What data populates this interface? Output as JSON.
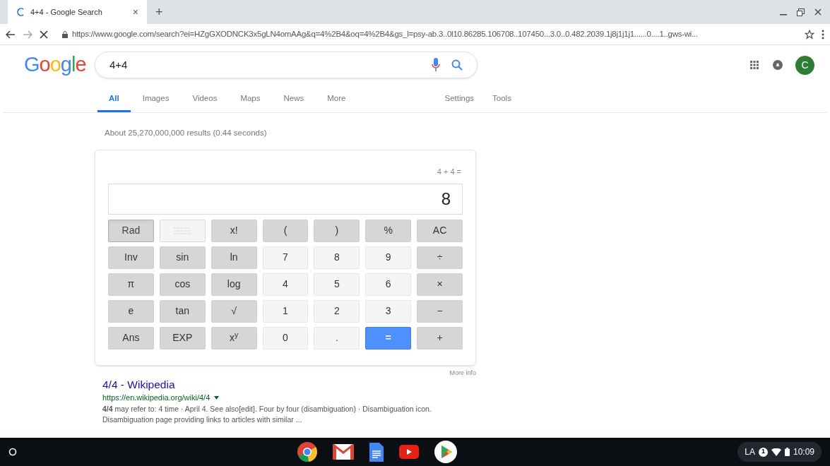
{
  "browser": {
    "tab": {
      "title": "4+4 - Google Search",
      "close": "×",
      "new_tab": "+"
    },
    "url": "https://www.google.com/search?ei=HZgGXODNCK3x5gLN4omAAg&q=4%2B4&oq=4%2B4&gs_l=psy-ab.3..0l10.86285.106708..107450...3.0..0.482.2039.1j8j1j1j1......0....1..gws-wi..."
  },
  "header": {
    "logo": "Google",
    "query": "4+4",
    "avatar": "C"
  },
  "nav": {
    "tabs": [
      {
        "label": "All",
        "selected": true
      },
      {
        "label": "Images",
        "selected": false
      },
      {
        "label": "Videos",
        "selected": false
      },
      {
        "label": "Maps",
        "selected": false
      },
      {
        "label": "News",
        "selected": false
      },
      {
        "label": "More",
        "selected": false
      }
    ],
    "right": [
      "Settings",
      "Tools"
    ]
  },
  "result_stats": "About 25,270,000,000 results (0.44 seconds)",
  "calculator": {
    "expression": "4 + 4 =",
    "display": "8",
    "more_info": "More info",
    "keys": [
      {
        "kind": "mode",
        "label": "Rad",
        "selected": true
      },
      {
        "kind": "mode",
        "selected": false
      },
      {
        "kind": "func",
        "label": "x!"
      },
      {
        "kind": "func",
        "label": "("
      },
      {
        "kind": "func",
        "label": ")"
      },
      {
        "kind": "func",
        "label": "%"
      },
      {
        "kind": "func",
        "label": "AC"
      },
      {
        "kind": "func",
        "label": "Inv"
      },
      {
        "kind": "func",
        "label": "sin"
      },
      {
        "kind": "func",
        "label": "ln"
      },
      {
        "kind": "num",
        "label": "7"
      },
      {
        "kind": "num",
        "label": "8"
      },
      {
        "kind": "num",
        "label": "9"
      },
      {
        "kind": "func",
        "label": "÷"
      },
      {
        "kind": "func",
        "label": "π"
      },
      {
        "kind": "func",
        "label": "cos"
      },
      {
        "kind": "func",
        "label": "log"
      },
      {
        "kind": "num",
        "label": "4"
      },
      {
        "kind": "num",
        "label": "5"
      },
      {
        "kind": "num",
        "label": "6"
      },
      {
        "kind": "func",
        "label": "×"
      },
      {
        "kind": "func",
        "label": "e"
      },
      {
        "kind": "func",
        "label": "tan"
      },
      {
        "kind": "func",
        "label": "√"
      },
      {
        "kind": "num",
        "label": "1"
      },
      {
        "kind": "num",
        "label": "2"
      },
      {
        "kind": "num",
        "label": "3"
      },
      {
        "kind": "func",
        "label": "−"
      },
      {
        "kind": "func",
        "label": "Ans"
      },
      {
        "kind": "func",
        "label": "EXP"
      },
      {
        "kind": "func",
        "label": "x$^{y}$"
      },
      {
        "kind": "num",
        "label": "0"
      },
      {
        "kind": "num",
        "label": "."
      },
      {
        "kind": "equals",
        "label": "="
      },
      {
        "kind": "func",
        "label": "+"
      }
    ]
  },
  "result": {
    "title": "4/4 - Wikipedia",
    "url": "https://en.wikipedia.org/wiki/4/4",
    "snippet": "**4/4** may refer to: 4 time · April 4. See also[edit]. Four by four (disambiguation) · Disambiguation icon. Disambiguation page providing links to articles with similar ..."
  },
  "shelf": {
    "ime": "LA",
    "notifications": "1",
    "time": "10:09"
  }
}
